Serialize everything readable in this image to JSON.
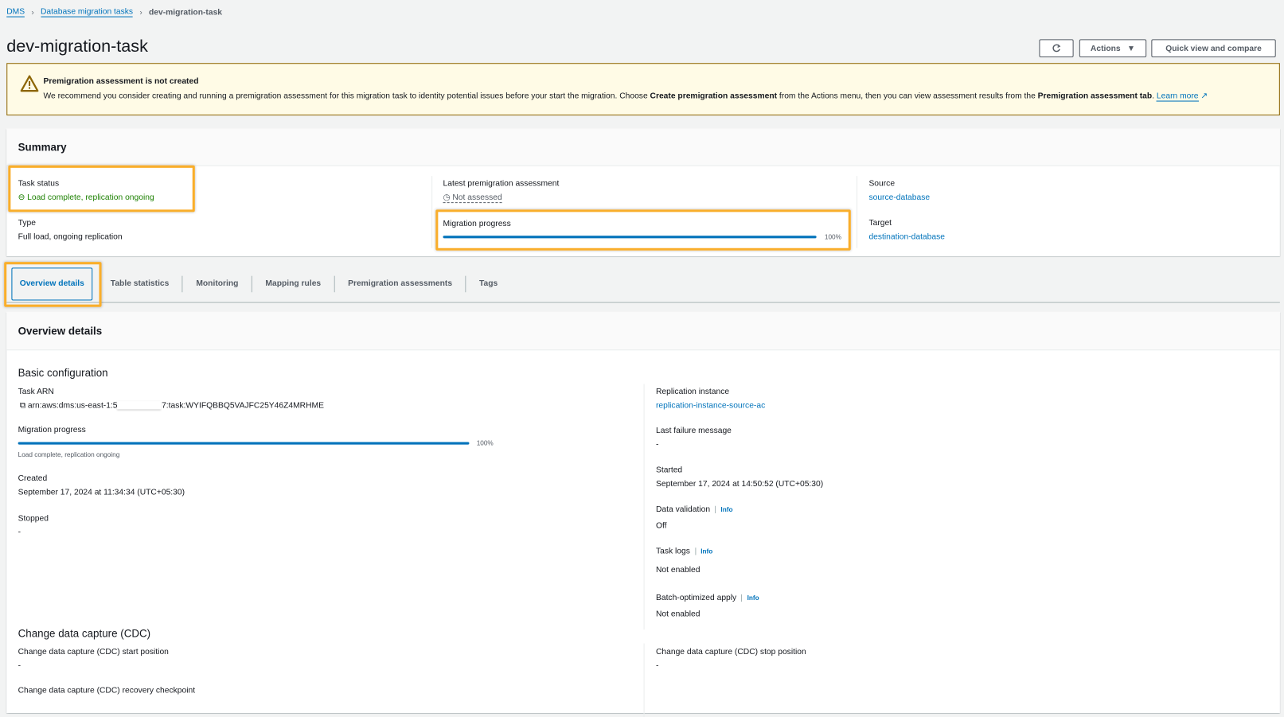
{
  "breadcrumb": [
    {
      "label": "DMS"
    },
    {
      "label": "Database migration tasks"
    },
    {
      "label": "dev-migration-task"
    }
  ],
  "page_title": "dev-migration-task",
  "header_buttons": {
    "refresh_icon": "refresh-icon",
    "actions": "Actions",
    "quick_view": "Quick view and compare"
  },
  "alert": {
    "title": "Premigration assessment is not created",
    "text_1": "We recommend you consider creating and running a premigration assessment for this migration task to identity potential issues before your start the migration. Choose ",
    "bold_1": "Create premigration assessment",
    "text_2": " from the Actions menu, then you can view assessment results from the ",
    "bold_2": "Premigration assessment tab",
    "text_3": ". ",
    "learn_more": "Learn more",
    "icon": "warning-icon",
    "color": "#8d6605"
  },
  "summary": {
    "title": "Summary",
    "task_status_label": "Task status",
    "task_status": "Load complete, replication ongoing",
    "type_label": "Type",
    "type": "Full load, ongoing replication",
    "assessment_label": "Latest premigration assessment",
    "assessment": "Not assessed",
    "progress_label": "Migration progress",
    "progress_percent": 100,
    "progress_text": "100%",
    "source_label": "Source",
    "source": "source-database",
    "target_label": "Target",
    "target": "destination-database"
  },
  "tabs": [
    {
      "label": "Overview details",
      "active": true
    },
    {
      "label": "Table statistics"
    },
    {
      "label": "Monitoring"
    },
    {
      "label": "Mapping rules"
    },
    {
      "label": "Premigration assessments"
    },
    {
      "label": "Tags"
    }
  ],
  "overview": {
    "title": "Overview details",
    "basic_config": "Basic configuration",
    "task_arn_label": "Task ARN",
    "task_arn_prefix": "arn:aws:dms:us-east-1:5",
    "task_arn_suffix": "7:task:WYIFQBBQ5VAJFC25Y46Z4MRHME",
    "progress_label": "Migration progress",
    "progress_percent": 100,
    "progress_text": "100%",
    "progress_status": "Load complete, replication ongoing",
    "created_label": "Created",
    "created": "September 17, 2024 at 11:34:34 (UTC+05:30)",
    "stopped_label": "Stopped",
    "stopped": "-",
    "replication_instance_label": "Replication instance",
    "replication_instance": "replication-instance-source-ac",
    "last_failure_label": "Last failure message",
    "last_failure": "-",
    "started_label": "Started",
    "started": "September 17, 2024 at 14:50:52 (UTC+05:30)",
    "data_validation_label": "Data validation",
    "data_validation": "Off",
    "task_logs_label": "Task logs",
    "task_logs": "Not enabled",
    "batch_label": "Batch-optimized apply",
    "batch": "Not enabled",
    "info": "Info",
    "cdc_title": "Change data capture (CDC)",
    "cdc_start_label": "Change data capture (CDC) start position",
    "cdc_start": "-",
    "cdc_stop_label": "Change data capture (CDC) stop position",
    "cdc_stop": "-",
    "cdc_recovery_label": "Change data capture (CDC) recovery checkpoint"
  },
  "highlight_color": "#f9ae2b"
}
